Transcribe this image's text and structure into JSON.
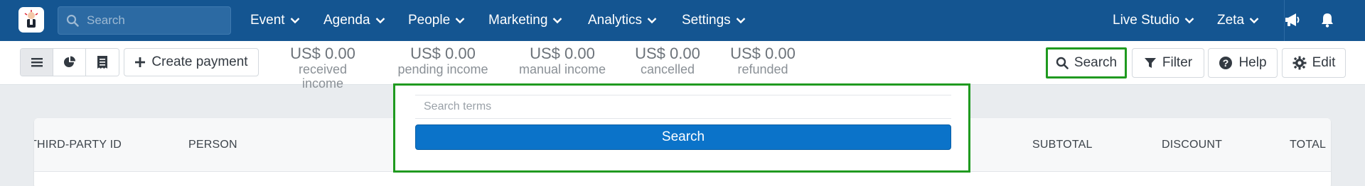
{
  "app": {
    "brand_color": "#145591",
    "accent": "#0b73c9",
    "highlight": "#1f9a1f"
  },
  "topnav": {
    "logo_icon": "app-logo",
    "search_placeholder": "Search",
    "menu": [
      {
        "label": "Event"
      },
      {
        "label": "Agenda"
      },
      {
        "label": "People"
      },
      {
        "label": "Marketing"
      },
      {
        "label": "Analytics"
      },
      {
        "label": "Settings"
      }
    ],
    "right": {
      "studio_label": "Live Studio",
      "user_label": "Zeta",
      "announce_icon": "megaphone-icon",
      "notifications_icon": "bell-icon"
    }
  },
  "toolbar": {
    "view_icons": [
      "list-icon",
      "pie-chart-icon",
      "receipt-icon"
    ],
    "create_label": "Create payment",
    "stats": [
      {
        "amount": "US$ 0.00",
        "label": "received income"
      },
      {
        "amount": "US$ 0.00",
        "label": "pending income"
      },
      {
        "amount": "US$ 0.00",
        "label": "manual income"
      },
      {
        "amount": "US$ 0.00",
        "label": "cancelled"
      },
      {
        "amount": "US$ 0.00",
        "label": "refunded"
      }
    ],
    "search_label": "Search",
    "filter_label": "Filter",
    "help_label": "Help",
    "edit_label": "Edit"
  },
  "search_popover": {
    "placeholder": "Search terms",
    "button_label": "Search"
  },
  "table": {
    "columns": [
      "THIRD-PARTY ID",
      "PERSON",
      "SUBTOTAL",
      "DISCOUNT",
      "TOTAL"
    ]
  }
}
